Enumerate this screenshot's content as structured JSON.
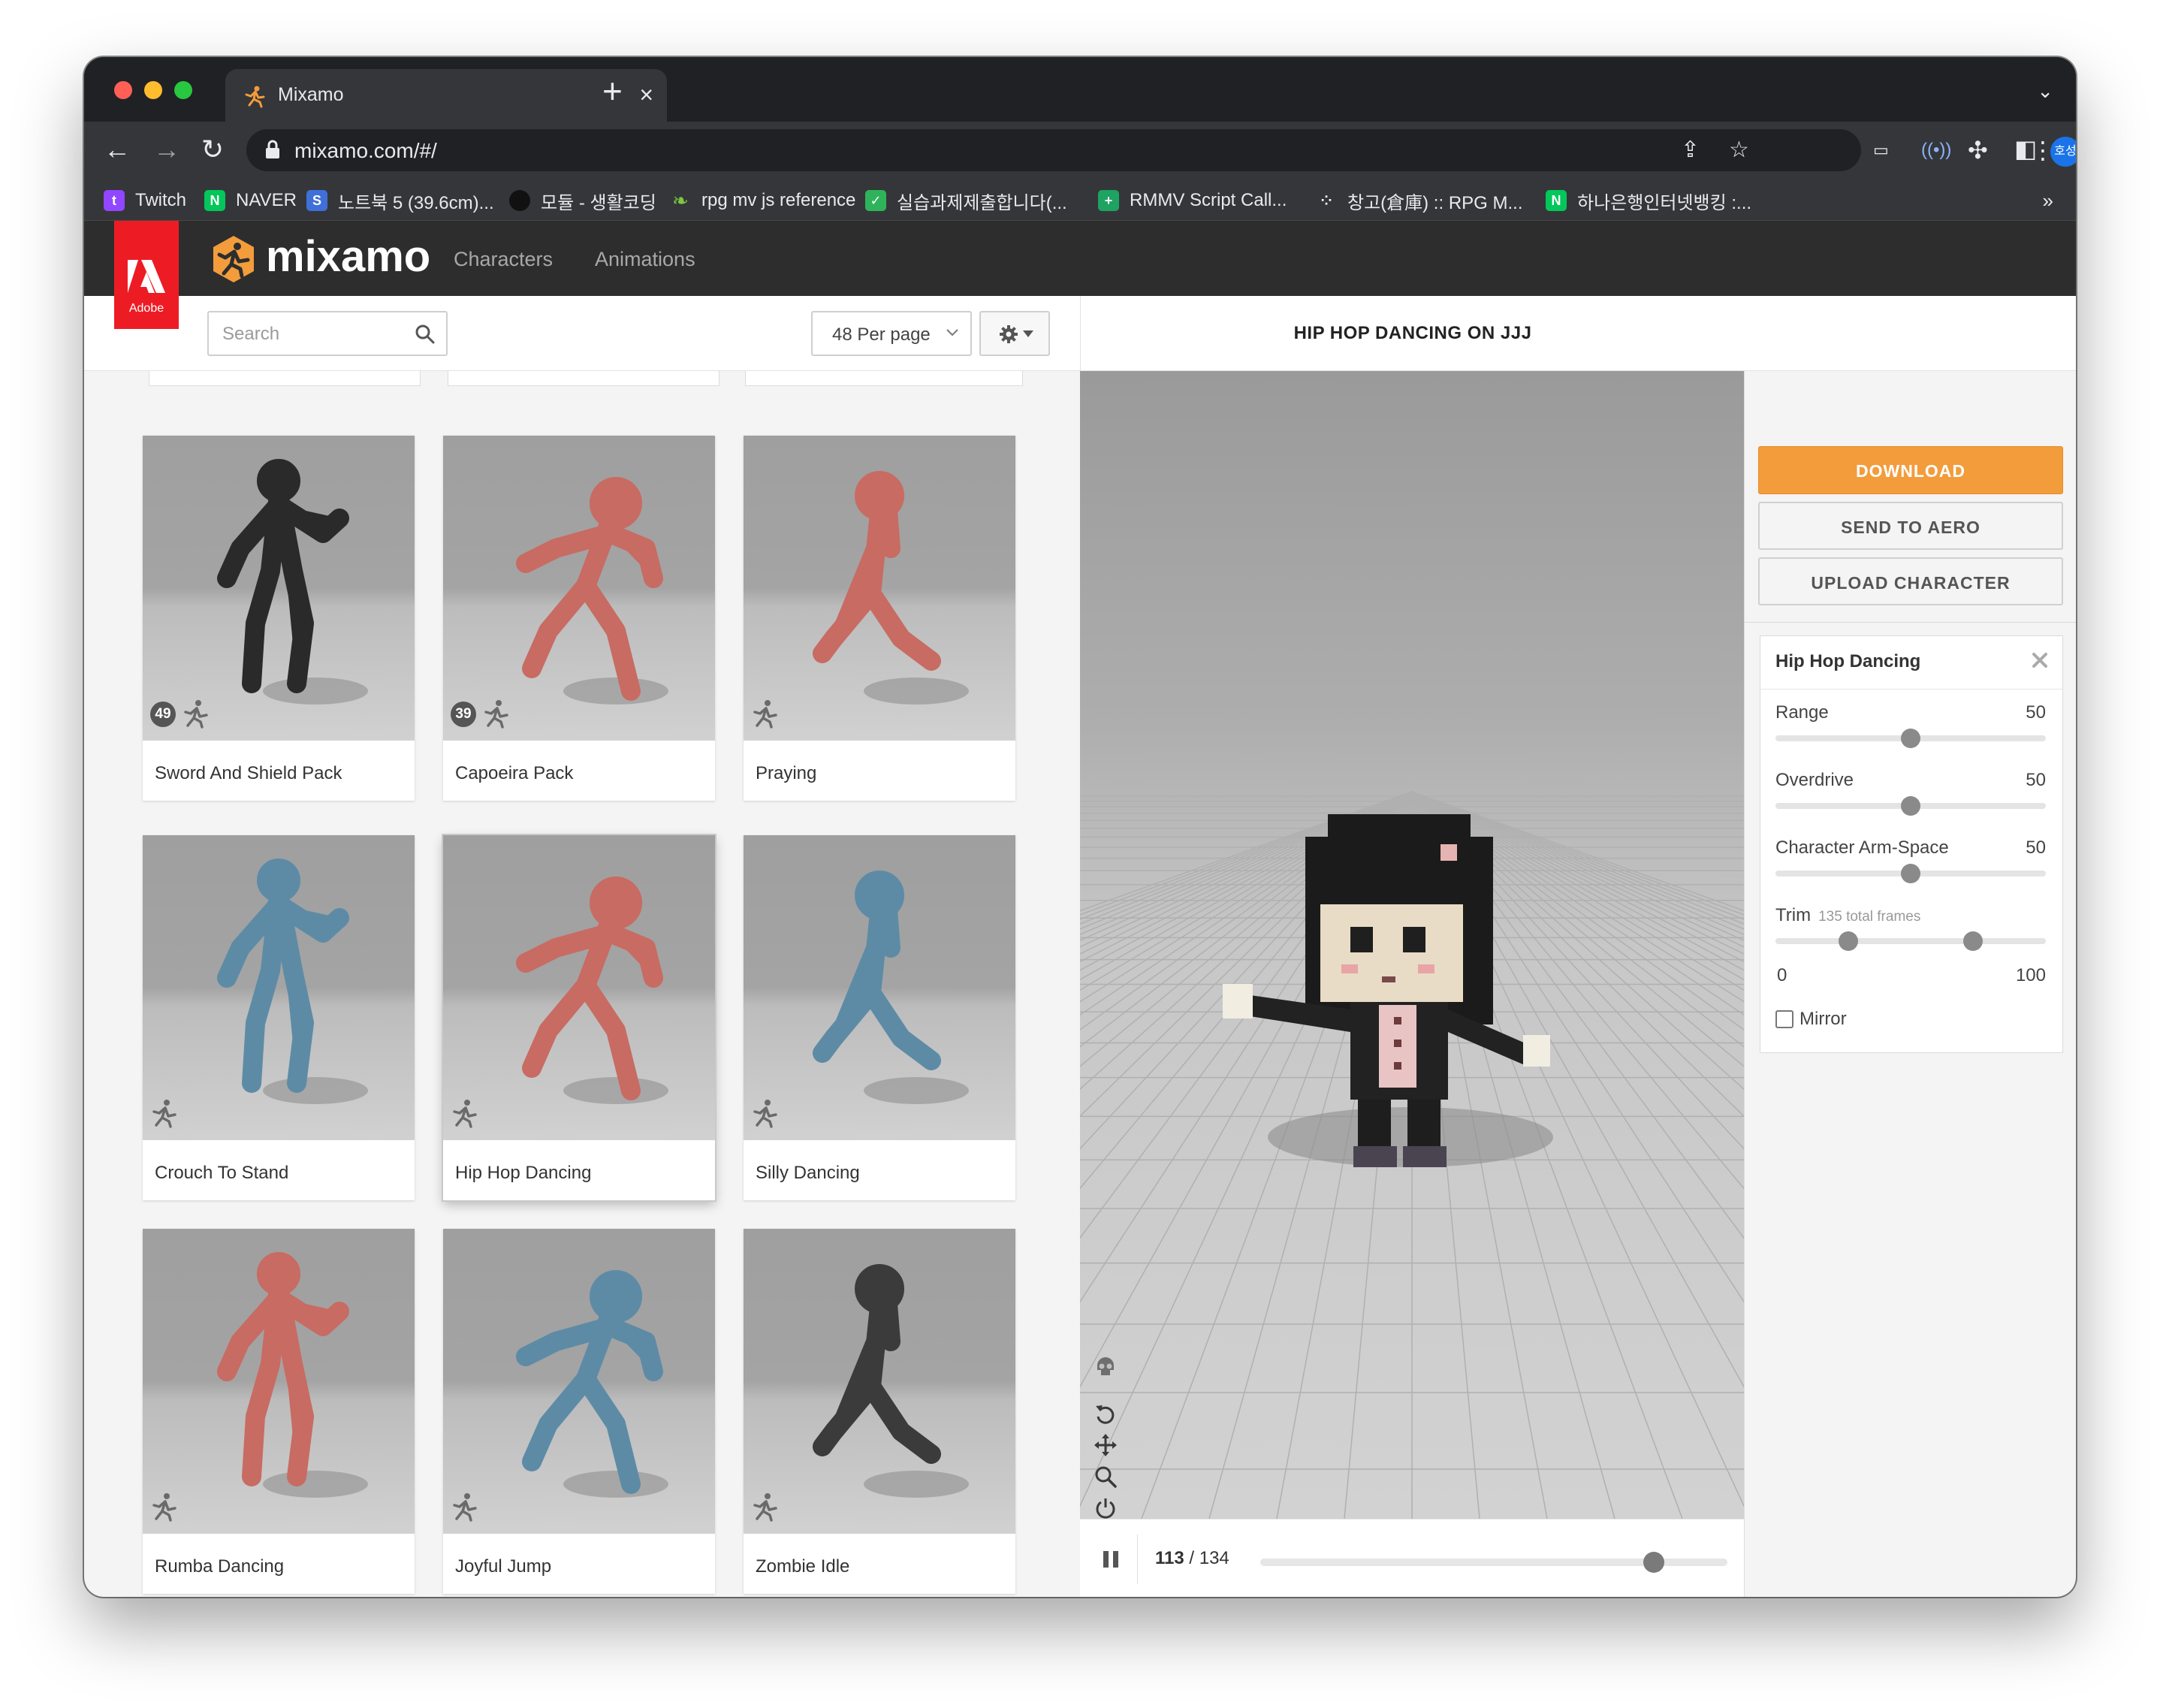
{
  "browser": {
    "tab_title": "Mixamo",
    "tab_close": "×",
    "new_tab": "+",
    "url": "mixamo.com/#/",
    "profile_initials": "호성",
    "bookmarks": [
      {
        "label": "Twitch",
        "icon_color": "#9146ff",
        "glyph": "t"
      },
      {
        "label": "NAVER",
        "icon_color": "#03c75a",
        "glyph": "N"
      },
      {
        "label": "노트북 5 (39.6cm)...",
        "icon_color": "#3f6fd8",
        "glyph": "S"
      },
      {
        "label": "모듈 - 생활코딩",
        "icon_color": "#111111",
        "glyph": ""
      },
      {
        "label": "rpg mv js reference",
        "icon_color": "#35363a",
        "glyph": ""
      },
      {
        "label": "실습과제제출합니다(...",
        "icon_color": "#2fb35a",
        "glyph": "✓"
      },
      {
        "label": "RMMV Script Call...",
        "icon_color": "#1ea362",
        "glyph": "+"
      },
      {
        "label": "창고(倉庫) :: RPG M...",
        "icon_color": "#35363a",
        "glyph": "⁘"
      },
      {
        "label": "하나은행인터넷뱅킹 :...",
        "icon_color": "#03c75a",
        "glyph": "N"
      }
    ],
    "bookmarks_more": "»"
  },
  "header": {
    "logo_text": "mixamo",
    "adobe_text": "Adobe",
    "nav": [
      "Characters",
      "Animations"
    ],
    "help_glyph": "?",
    "user": "호성"
  },
  "toolbar": {
    "search_placeholder": "Search",
    "per_page": "48 Per page"
  },
  "cards": [
    {
      "label": "Sword And Shield Pack",
      "count": "49",
      "pack": true,
      "color": "#2a2a2a"
    },
    {
      "label": "Capoeira Pack",
      "count": "39",
      "pack": true,
      "color": "#c86b63"
    },
    {
      "label": "Praying",
      "count": "",
      "pack": false,
      "color": "#c86b63"
    },
    {
      "label": "Crouch To Stand",
      "count": "",
      "pack": false,
      "color": "#5d8ba6"
    },
    {
      "label": "Hip Hop Dancing",
      "count": "",
      "pack": false,
      "color": "#c86b63"
    },
    {
      "label": "Silly Dancing",
      "count": "",
      "pack": false,
      "color": "#5d8ba6"
    },
    {
      "label": "Rumba Dancing",
      "count": "",
      "pack": false,
      "color": "#c86b63"
    },
    {
      "label": "Joyful Jump",
      "count": "",
      "pack": false,
      "color": "#5d8ba6"
    },
    {
      "label": "Zombie Idle",
      "count": "",
      "pack": false,
      "color": "#3b3b3b"
    }
  ],
  "viewer": {
    "title": "HIP HOP DANCING ON JJJ",
    "current_frame": "113",
    "frame_sep": " / ",
    "total_frame": "134",
    "progress": 0.843
  },
  "actions": {
    "download": "DOWNLOAD",
    "send_to_aero": "SEND TO AERO",
    "upload_character": "UPLOAD CHARACTER"
  },
  "settings": {
    "title": "Hip Hop Dancing",
    "params": [
      {
        "label": "Range",
        "value": "50",
        "fraction": 0.5
      },
      {
        "label": "Overdrive",
        "value": "50",
        "fraction": 0.5
      },
      {
        "label": "Character Arm-Space",
        "value": "50",
        "fraction": 0.5
      }
    ],
    "trim": {
      "label": "Trim",
      "sub": "135 total frames",
      "min_label": "0",
      "max_label": "100",
      "start_fraction": 0.27,
      "end_fraction": 0.73
    },
    "mirror_label": "Mirror"
  },
  "colors": {
    "accent": "#f39c3c",
    "header_bg": "#2d2d2d",
    "adobe_red": "#ed1c24"
  }
}
